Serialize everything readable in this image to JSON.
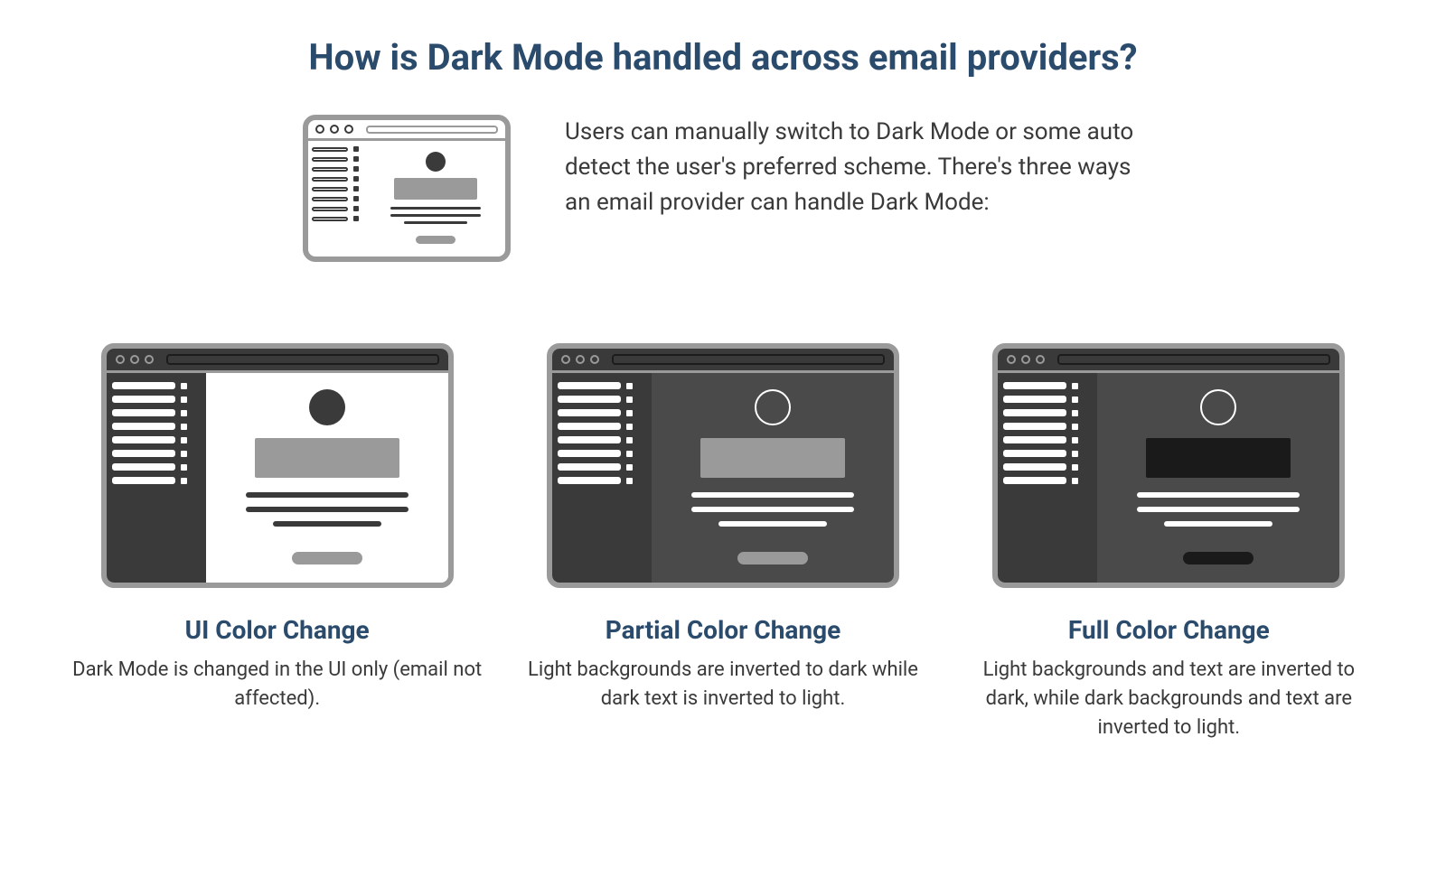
{
  "title": "How is Dark Mode handled across email providers?",
  "intro": "Users can manually switch to Dark Mode or some auto detect the user's preferred scheme. There's three ways an email provider can handle Dark Mode:",
  "cards": [
    {
      "title": "UI Color Change",
      "desc": "Dark Mode is changed in the UI only (email not affected)."
    },
    {
      "title": "Partial Color Change",
      "desc": "Light backgrounds are inverted to dark while dark text is inverted to light."
    },
    {
      "title": "Full Color Change",
      "desc": "Light backgrounds and text are inverted to dark, while dark backgrounds and text are inverted to light."
    }
  ],
  "colors": {
    "heading": "#2a4b6b",
    "body": "#3a3a3a",
    "chrome_border": "#9a9a9a",
    "dark_fill": "#3a3a3a",
    "mid_fill": "#4a4a4a",
    "black_fill": "#1a1a1a",
    "light_gray": "#9a9a9a",
    "white": "#ffffff"
  }
}
